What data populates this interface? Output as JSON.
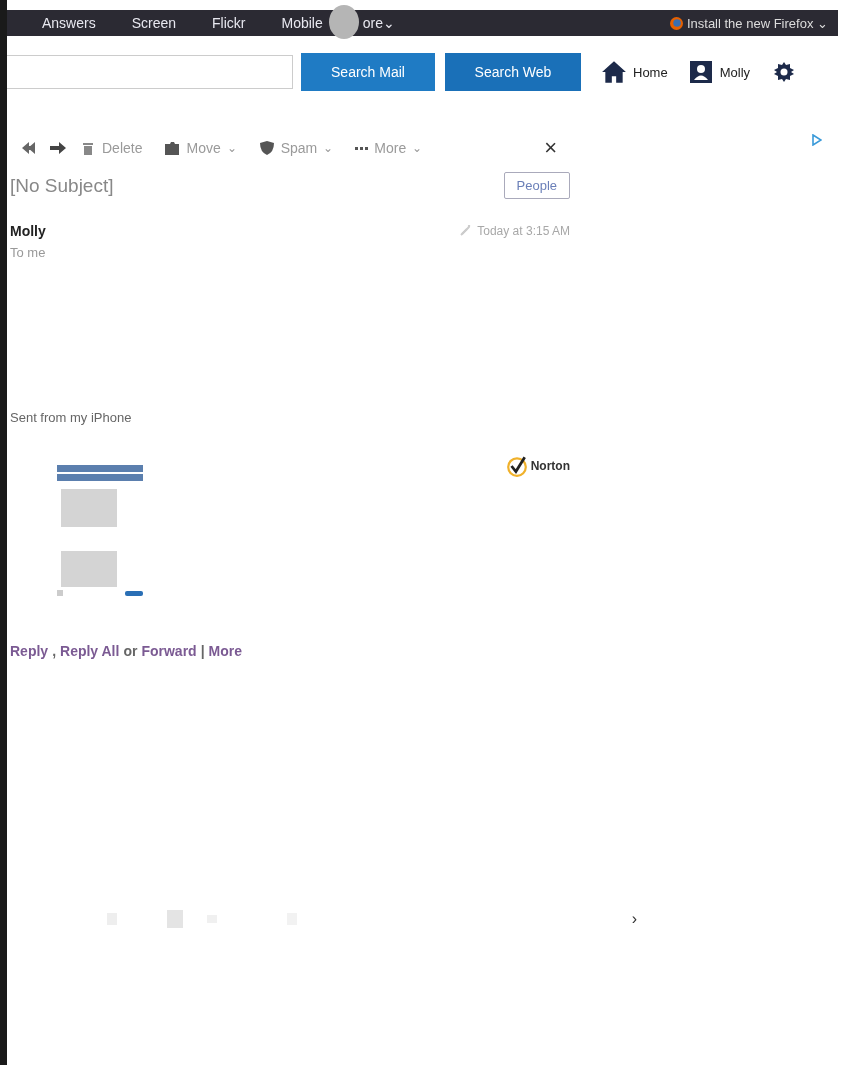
{
  "top_nav": {
    "items": [
      {
        "label": "Answers"
      },
      {
        "label": "Screen"
      },
      {
        "label": "Flickr"
      },
      {
        "label": "Mobile"
      },
      {
        "label": "ore",
        "caret": "⌄"
      }
    ],
    "promo": "Install the new Firefox ⌄"
  },
  "search": {
    "buttons": [
      "Search Mail",
      "Search Web"
    ]
  },
  "header_links": {
    "home": "Home",
    "profile": "Molly"
  },
  "toolbar": {
    "items": [
      {
        "kind": "icon"
      },
      {
        "kind": "text",
        "label": "Delete"
      },
      {
        "kind": "menu",
        "label": "Move",
        "caret": "⌄"
      },
      {
        "kind": "menu",
        "label": "Spam",
        "caret": "⌄"
      },
      {
        "kind": "menu",
        "label": "More",
        "caret": "⌄"
      }
    ],
    "close": "×"
  },
  "message": {
    "subject": "[No Subject]",
    "people_button": "People",
    "sender": "Molly",
    "recipient": "To  me",
    "timestamp": "Today at 3:15 AM",
    "body": "Sent from my iPhone",
    "badge": "Norton",
    "actions": [
      {
        "label": "Reply",
        "kind": "link"
      },
      {
        "label": ",",
        "kind": "sep"
      },
      {
        "label": "Reply All",
        "kind": "link"
      },
      {
        "label": "or",
        "kind": "sep"
      },
      {
        "label": "Forward",
        "kind": "link"
      },
      {
        "label": "|",
        "kind": "sep"
      },
      {
        "label": "More",
        "kind": "link"
      }
    ]
  },
  "composer": {
    "next": "›"
  }
}
